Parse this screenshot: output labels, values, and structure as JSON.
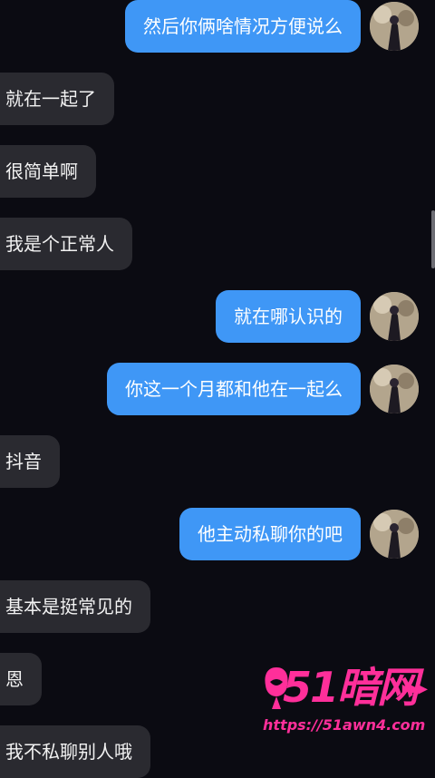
{
  "theme": {
    "background": "#0b0b12",
    "incoming_bubble": "#2a2a30",
    "outgoing_bubble": "#3f97f6",
    "watermark_color": "#ff2f9a"
  },
  "messages": [
    {
      "direction": "out",
      "text": "然后你俩啥情况方便说么",
      "avatar": "user-avatar"
    },
    {
      "direction": "in",
      "text": "就在一起了"
    },
    {
      "direction": "in",
      "text": "很简单啊"
    },
    {
      "direction": "in",
      "text": "我是个正常人"
    },
    {
      "direction": "out",
      "text": "就在哪认识的",
      "avatar": "user-avatar"
    },
    {
      "direction": "out",
      "text": "你这一个月都和他在一起么",
      "avatar": "user-avatar"
    },
    {
      "direction": "in",
      "text": "抖音"
    },
    {
      "direction": "out",
      "text": "他主动私聊你的吧",
      "avatar": "user-avatar"
    },
    {
      "direction": "in",
      "text": "基本是挺常见的"
    },
    {
      "direction": "in",
      "text": "恩"
    },
    {
      "direction": "in",
      "text": "我不私聊别人哦"
    }
  ],
  "watermark": {
    "brand": "51暗网",
    "url": "https://51awn4.com",
    "icon": "mascot-icon"
  }
}
